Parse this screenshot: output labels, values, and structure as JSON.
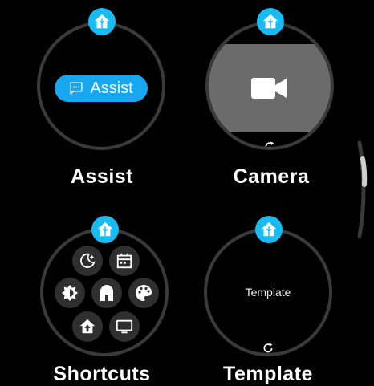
{
  "tiles": {
    "assist": {
      "title": "Assist",
      "chip_label": "Assist"
    },
    "camera": {
      "title": "Camera"
    },
    "shortcuts": {
      "title": "Shortcuts"
    },
    "template": {
      "title": "Template",
      "content": "Template"
    }
  },
  "icons": {
    "badge": "home-assistant-icon",
    "assist_chip": "chat-icon",
    "camera": "videocam-icon",
    "refresh": "refresh-icon",
    "shortcuts": [
      "night-mode-icon",
      "calendar-icon",
      "brightness-icon",
      "home-door-icon",
      "palette-icon",
      "home-up-icon",
      "tv-icon"
    ]
  },
  "colors": {
    "accent": "#18bcf2",
    "chip": "#18a6f0",
    "tile_border": "#3a3a3a",
    "camera_band": "#6b6b6b",
    "shortcut_bg": "#2f2f2f"
  }
}
